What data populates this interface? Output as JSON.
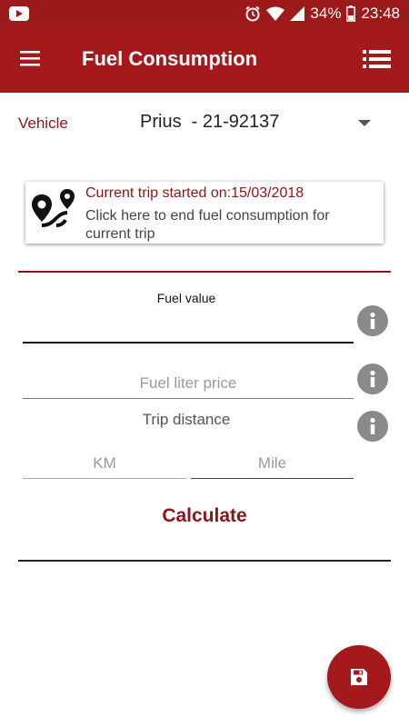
{
  "status_bar": {
    "battery": "34%",
    "time": "23:48"
  },
  "app_bar": {
    "title": "Fuel Consumption",
    "icons": [
      "hamburger-menu-icon",
      "list-icon"
    ]
  },
  "vehicle": {
    "label": "Vehicle",
    "selected": "Prius  - 21-92137"
  },
  "trip_card": {
    "started_text": "Current trip started on:15/03/2018",
    "hint": "Click here to end fuel consumption for current trip"
  },
  "form": {
    "fuel_value_label": "Fuel value",
    "fuel_value": "",
    "fuel_price_placeholder": "Fuel liter price",
    "trip_distance_label": "Trip distance",
    "km_placeholder": "KM",
    "mile_placeholder": "Mile",
    "calculate_label": "Calculate"
  },
  "colors": {
    "primary": "#a3191c",
    "status_bar": "#9d1a1b",
    "accent_text": "#8b1517",
    "info_grey": "#8a8a8a"
  }
}
